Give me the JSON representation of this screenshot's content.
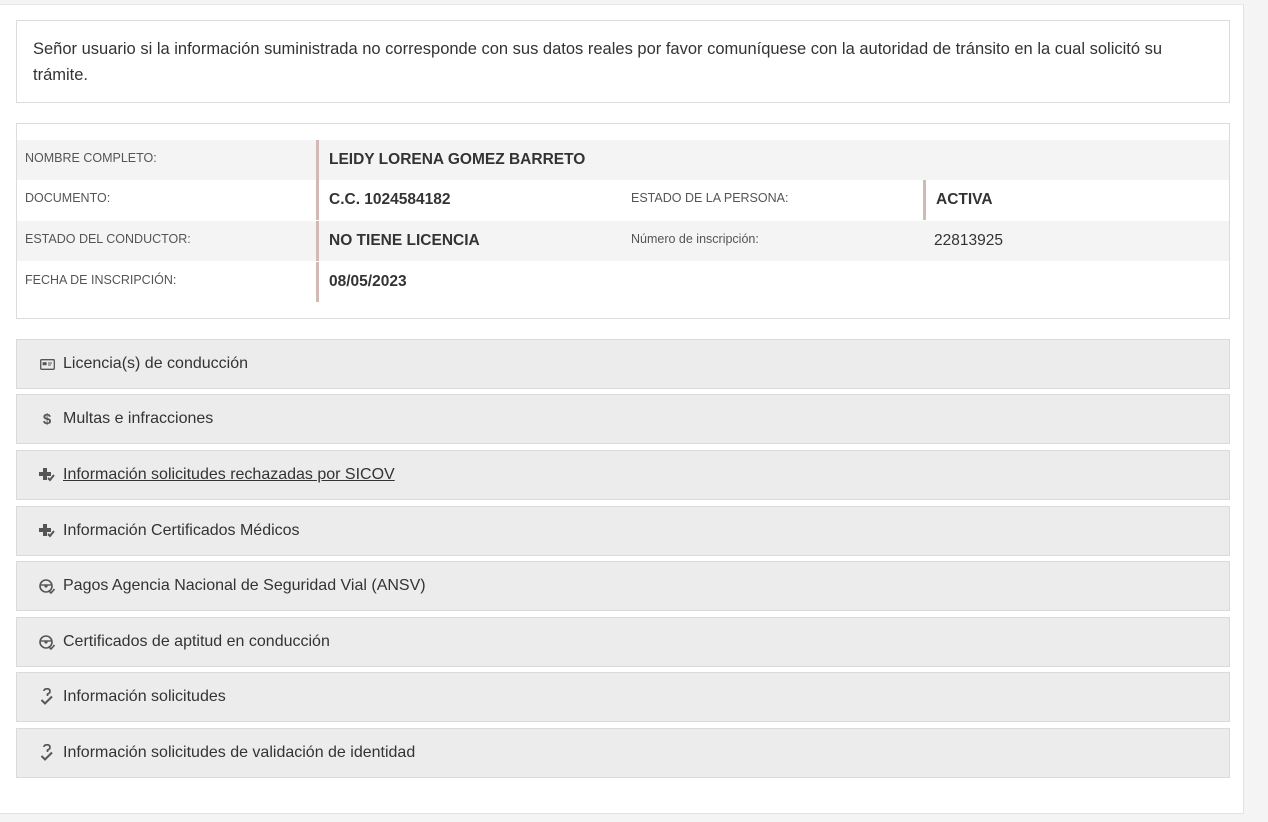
{
  "notice": {
    "text": "Señor usuario si la información suministrada no corresponde con sus datos reales por favor comuníquese con la autoridad de tránsito en la cual solicitó su trámite."
  },
  "person": {
    "nombre_label": "NOMBRE COMPLETO:",
    "nombre_value": "LEIDY LORENA GOMEZ BARRETO",
    "documento_label": "DOCUMENTO:",
    "documento_value": "C.C. 1024584182",
    "estado_persona_label": "ESTADO DE LA PERSONA:",
    "estado_persona_value": "ACTIVA",
    "estado_conductor_label": "ESTADO DEL CONDUCTOR:",
    "estado_conductor_value": "NO TIENE LICENCIA",
    "inscripcion_num_label": "Número de inscripción:",
    "inscripcion_num_value": "22813925",
    "fecha_label": "FECHA DE INSCRIPCIÓN:",
    "fecha_value": "08/05/2023"
  },
  "sections": [
    {
      "label": "Licencia(s) de conducción",
      "icon": "id-card-icon"
    },
    {
      "label": "Multas e infracciones",
      "icon": "dollar-icon"
    },
    {
      "label": "Información solicitudes rechazadas por SICOV",
      "icon": "medical-plus-icon"
    },
    {
      "label": "Información Certificados Médicos",
      "icon": "medical-plus-icon"
    },
    {
      "label": "Pagos Agencia Nacional de Seguridad Vial (ANSV)",
      "icon": "steering-wheel-icon"
    },
    {
      "label": "Certificados de aptitud en conducción",
      "icon": "steering-wheel-icon"
    },
    {
      "label": "Información solicitudes",
      "icon": "question-check-icon"
    },
    {
      "label": "Información solicitudes de validación de identidad",
      "icon": "question-check-icon"
    }
  ],
  "colors": {
    "row_shade": "#f4f4f4",
    "value_bar": "#d3b9b6",
    "accordion_bg": "#ececec"
  }
}
